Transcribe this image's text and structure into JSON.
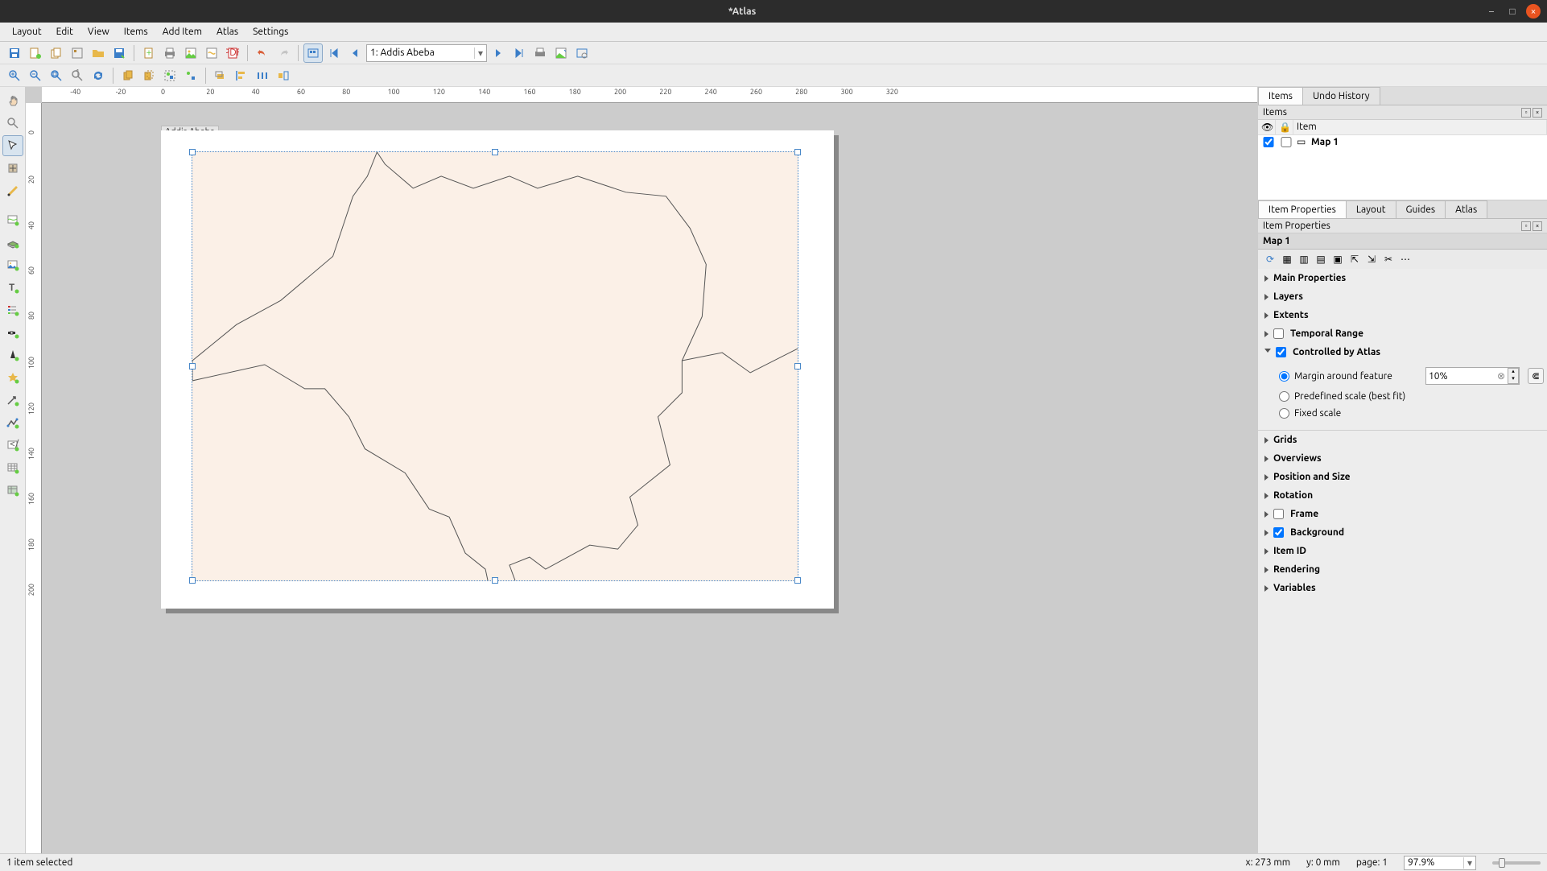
{
  "window": {
    "title": "*Atlas"
  },
  "menubar": [
    "Layout",
    "Edit",
    "View",
    "Items",
    "Add Item",
    "Atlas",
    "Settings"
  ],
  "atlas_toolbar": {
    "feature_selected": "1: Addis Abeba"
  },
  "canvas": {
    "caption": "Addis Abeba",
    "hruler_ticks": [
      -40,
      -20,
      0,
      20,
      40,
      60,
      80,
      100,
      120,
      140,
      160,
      180,
      200,
      220,
      240,
      260,
      280,
      300,
      320
    ],
    "vruler_ticks": [
      0,
      20,
      40,
      60,
      80,
      100,
      120,
      140,
      160,
      180,
      200
    ]
  },
  "items_panel": {
    "tab_items": "Items",
    "tab_undo": "Undo History",
    "panel_title": "Items",
    "header_item": "Item",
    "row": {
      "name": "Map 1",
      "visible": true,
      "locked": false
    }
  },
  "props_panel": {
    "tab_item_properties": "Item Properties",
    "tab_layout": "Layout",
    "tab_guides": "Guides",
    "tab_atlas": "Atlas",
    "panel_title": "Item Properties",
    "item_name": "Map 1",
    "sections": {
      "main_properties": "Main Properties",
      "layers": "Layers",
      "extents": "Extents",
      "temporal_range": "Temporal Range",
      "controlled_by_atlas": "Controlled by Atlas",
      "grids": "Grids",
      "overviews": "Overviews",
      "position_and_size": "Position and Size",
      "rotation": "Rotation",
      "frame": "Frame",
      "background": "Background",
      "item_id": "Item ID",
      "rendering": "Rendering",
      "variables": "Variables"
    },
    "atlas": {
      "margin_label": "Margin around feature",
      "margin_value": "10%",
      "predefined_label": "Predefined scale (best fit)",
      "fixed_label": "Fixed scale"
    }
  },
  "statusbar": {
    "selection": "1 item selected",
    "x": "x: 273 mm",
    "y": "y: 0 mm",
    "page": "page: 1",
    "zoom": "97.9%"
  }
}
